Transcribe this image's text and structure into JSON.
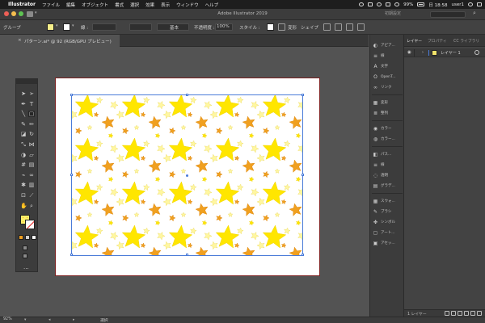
{
  "menubar": {
    "app_name": "Illustrator",
    "items": [
      "ファイル",
      "編集",
      "オブジェクト",
      "書式",
      "選択",
      "効果",
      "表示",
      "ウィンドウ",
      "ヘルプ"
    ],
    "battery": "99%",
    "clock": "日 18:58",
    "user": "user1"
  },
  "titlebar": {
    "title": "Adobe Illustrator 2019",
    "search_label": "初期設定",
    "search_icon": "search-icon"
  },
  "controlbar": {
    "selection_label": "グループ",
    "stroke_label": "線 :",
    "brush_label": "基本",
    "opacity_label": "不透明度 :",
    "opacity_value": "100%",
    "style_label": "スタイル :",
    "transform_label": "変形",
    "shape_label": "シェイプ",
    "fill_color": "#f7ef8a",
    "stroke_color": "#ffffff"
  },
  "document": {
    "tab_title": "パターン.ai* @ 92 (RGB/GPU プレビュー)",
    "close_glyph": "×"
  },
  "tools": {
    "icons": [
      "selection-icon",
      "direct-selection-icon",
      "pen-icon",
      "type-icon",
      "line-icon",
      "rectangle-icon",
      "brush-icon",
      "pencil-icon",
      "eraser-icon",
      "rotate-icon",
      "scale-icon",
      "width-icon",
      "shape-builder-icon",
      "perspective-icon",
      "mesh-icon",
      "gradient-icon",
      "eyedropper-icon",
      "blend-icon",
      "symbol-icon",
      "graph-icon",
      "artboard-icon",
      "slice-icon",
      "hand-icon",
      "zoom-icon"
    ],
    "more_label": "..."
  },
  "artwork": {
    "colors": {
      "yellow": "#ffe600",
      "light": "#fff7a0",
      "orange": "#f0a020"
    },
    "selection_color": "#4a7bd8"
  },
  "right_panels": [
    {
      "icon": "appearance-icon",
      "label": "アピア..."
    },
    {
      "icon": "stroke-panel-icon",
      "label": "線"
    },
    {
      "icon": "text-icon",
      "label": "文字"
    },
    {
      "icon": "opentype-icon",
      "label": "OpenT..."
    },
    {
      "icon": "link-icon",
      "label": "リンク"
    },
    {
      "icon": "layers-thumb-icon",
      "label": "変形"
    },
    {
      "icon": "paragraph-icon",
      "label": "整列"
    },
    {
      "icon": "color-icon",
      "label": "カラー"
    },
    {
      "icon": "color-guide-icon",
      "label": "カラー..."
    },
    {
      "icon": "pathfinder-icon",
      "label": "パス..."
    },
    {
      "icon": "stroke-weight-icon",
      "label": "線"
    },
    {
      "icon": "transparency-icon",
      "label": "透明"
    },
    {
      "icon": "gradient-panel-icon",
      "label": "グラデ..."
    },
    {
      "icon": "swatches-icon",
      "label": "スウォ..."
    },
    {
      "icon": "brushes-icon",
      "label": "ブラシ"
    },
    {
      "icon": "symbols-icon",
      "label": "シンボル"
    },
    {
      "icon": "artboards-icon",
      "label": "アート..."
    },
    {
      "icon": "asset-icon",
      "label": "アセッ..."
    }
  ],
  "layers_panel": {
    "tabs": [
      "レイヤー",
      "プロパティ",
      "CC ライブラリ"
    ],
    "layer_name": "レイヤー 1",
    "footer_count": "1 レイヤー"
  },
  "statusbar": {
    "zoom": "92%",
    "tool_status": "選択"
  }
}
